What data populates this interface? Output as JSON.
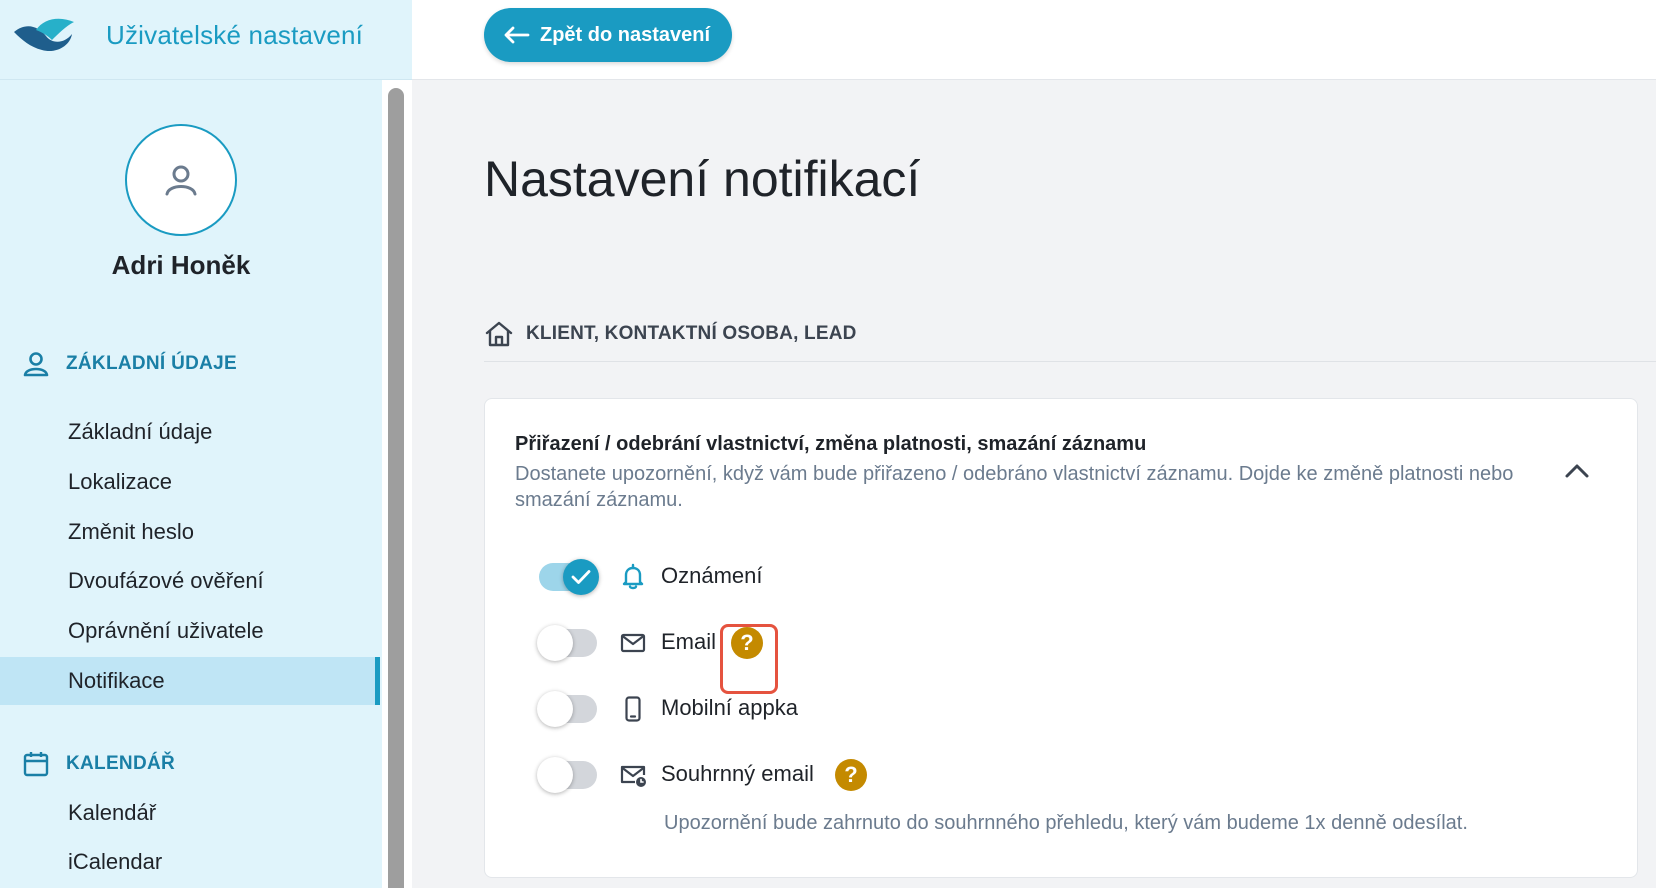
{
  "app": {
    "title": "Uživatelské nastavení"
  },
  "topbar": {
    "back_label": "Zpět do nastavení"
  },
  "user": {
    "name": "Adri Honěk"
  },
  "sidebar": {
    "sections": [
      {
        "title": "ZÁKLADNÍ ÚDAJE",
        "icon": "person-icon",
        "items": [
          "Základní údaje",
          "Lokalizace",
          "Změnit heslo",
          "Dvoufázové ověření",
          "Oprávnění uživatele",
          "Notifikace"
        ]
      },
      {
        "title": "KALENDÁŘ",
        "icon": "calendar-icon",
        "items": [
          "Kalendář",
          "iCalendar"
        ]
      }
    ],
    "active_item": "Notifikace"
  },
  "page": {
    "title": "Nastavení notifikací",
    "category": "KLIENT, KONTAKTNÍ OSOBA, LEAD"
  },
  "card": {
    "title": "Přiřazení / odebrání vlastnictví, změna platnosti, smazání záznamu",
    "description": "Dostanete upozornění, když vám bude přiřazeno / odebráno vlastnictví záznamu. Dojde ke změně platnosti nebo smazání záznamu.",
    "options": [
      {
        "label": "Oznámení",
        "icon": "bell-icon",
        "enabled": true
      },
      {
        "label": "Email",
        "icon": "envelope-icon",
        "enabled": false,
        "help": "?"
      },
      {
        "label": "Mobilní appka",
        "icon": "phone-icon",
        "enabled": false
      },
      {
        "label": "Souhrnný email",
        "icon": "envelope-clock-icon",
        "enabled": false,
        "help": "?",
        "sub": "Upozornění bude zahrnuto do souhrnného přehledu, který vám budeme 1x denně odesílat."
      }
    ]
  },
  "colors": {
    "accent": "#1a9bc2",
    "help": "#c48a00",
    "highlight": "#e5533f",
    "sidebar_bg": "#e0f4fb"
  }
}
